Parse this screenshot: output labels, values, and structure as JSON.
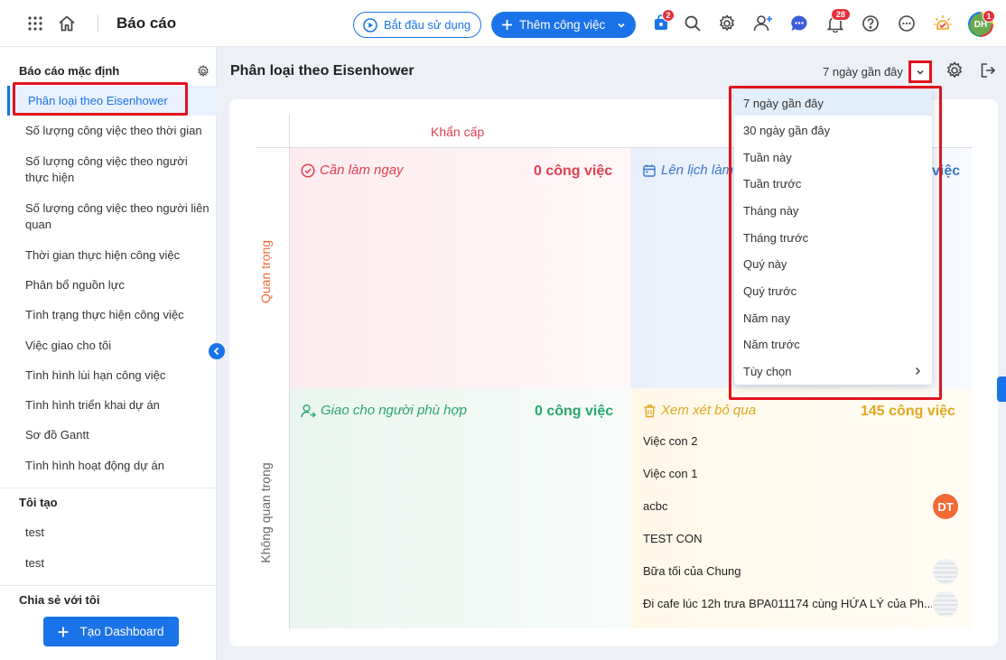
{
  "header": {
    "title": "Báo cáo",
    "start_button": "Bắt đầu sử dụng",
    "add_task_button": "Thêm công việc",
    "cart_badge": "2",
    "notification_badge": "28",
    "avatar_initials": "DH",
    "avatar_badge": "1"
  },
  "sidebar": {
    "default_section": "Báo cáo mặc định",
    "items": [
      "Phân loại theo Eisenhower",
      "Số lượng công việc theo thời gian",
      "Số lượng công việc theo người thực hiện",
      "Số lượng công việc theo người liên quan",
      "Thời gian thực hiện công việc",
      "Phân bổ nguồn lực",
      "Tình trạng thực hiện công việc",
      "Việc giao cho tôi",
      "Tình hình lùi hạn công việc",
      "Tình hình triển khai dự án",
      "Sơ đồ Gantt",
      "Tình hình hoạt động dự án"
    ],
    "mine_section": "Tôi tạo",
    "mine_items": [
      "test",
      "test"
    ],
    "shared_section": "Chia sẻ với tôi",
    "create_dashboard": "Tạo Dashboard"
  },
  "main": {
    "title": "Phân loại theo Eisenhower",
    "range": "7 ngày gần đây",
    "col_urgent": "Khẩn cấp",
    "row_important": "Quan trọng",
    "row_not_important": "Không quan trọng",
    "quadrants": {
      "do_now": {
        "title": "Cần làm ngay",
        "count": "0 công việc",
        "color": "#e0404f"
      },
      "schedule": {
        "title": "Lên lịch làm",
        "count_suffix": "việc",
        "color": "#3a78c9"
      },
      "delegate": {
        "title": "Giao cho người phù hợp",
        "count": "0 công việc",
        "color": "#2aa56f"
      },
      "eliminate": {
        "title": "Xem xét bỏ qua",
        "count": "145 công việc",
        "color": "#e0a81e"
      }
    },
    "tasks": [
      {
        "name": "Việc con 2"
      },
      {
        "name": "Việc con 1"
      },
      {
        "name": "acbc",
        "avatar": "DT"
      },
      {
        "name": "TEST CON"
      },
      {
        "name": "Bữa tối của Chung"
      },
      {
        "name": "Đi cafe lúc 12h trưa BPA011174 cùng HỨA LÝ của Ph..."
      }
    ]
  },
  "dropdown": {
    "options": [
      "7 ngày gần đây",
      "30 ngày gần đây",
      "Tuần này",
      "Tuần trước",
      "Tháng này",
      "Tháng trước",
      "Quý này",
      "Quý trước",
      "Năm nay",
      "Năm trước",
      "Tùy chọn"
    ],
    "selected": "7 ngày gần đây"
  }
}
